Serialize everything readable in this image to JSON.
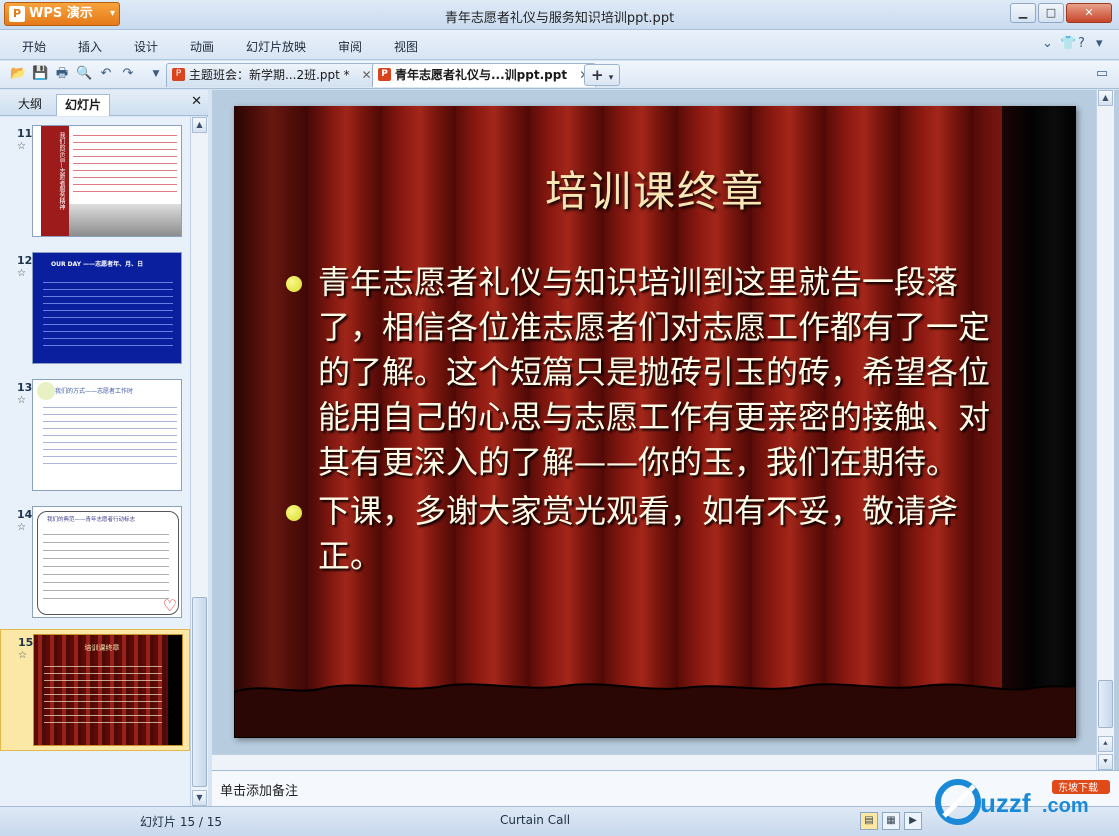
{
  "app": {
    "name": "WPS 演示",
    "window_title": "青年志愿者礼仪与服务知识培训ppt.ppt"
  },
  "menu": [
    "开始",
    "插入",
    "设计",
    "动画",
    "幻灯片放映",
    "审阅",
    "视图"
  ],
  "tabs": [
    {
      "label": "主题班会：新学期...2班.ppt *",
      "active": false
    },
    {
      "label": "青年志愿者礼仪与...训ppt.ppt",
      "active": true
    }
  ],
  "panel": {
    "tabs": [
      "大纲",
      "幻灯片"
    ],
    "active_tab": "幻灯片",
    "thumbnails": [
      {
        "number": "11",
        "vertical_title": "我们的宗旨—志愿者服务精神"
      },
      {
        "number": "12",
        "title": "OUR DAY ——志愿者年、月、日"
      },
      {
        "number": "13",
        "title": "我们的方式——志愿者工作时"
      },
      {
        "number": "14",
        "title": "我们的典范——青年志愿者行动标志"
      },
      {
        "number": "15",
        "title": "培训课终章"
      }
    ],
    "selected_index": 4
  },
  "slide": {
    "title": "培训课终章",
    "bullets": [
      "青年志愿者礼仪与知识培训到这里就告一段落了，相信各位准志愿者们对志愿工作都有了一定的了解。这个短篇只是抛砖引玉的砖，希望各位能用自己的心思与志愿工作有更亲密的接触、对其有更深入的了解——你的玉，我们在期待。",
      "下课，多谢大家赏光观看，如有不妥，敬请斧正。"
    ]
  },
  "notes": {
    "placeholder": "单击添加备注"
  },
  "status": {
    "slide_counter": "幻灯片 15 / 15",
    "theme": "Curtain Call"
  },
  "colors": {
    "accent_orange": "#e5791a",
    "title_text": "#f7e7b6",
    "bullet_dot": "#e8eb4a",
    "selected_thumb": "#fbe8a6"
  }
}
